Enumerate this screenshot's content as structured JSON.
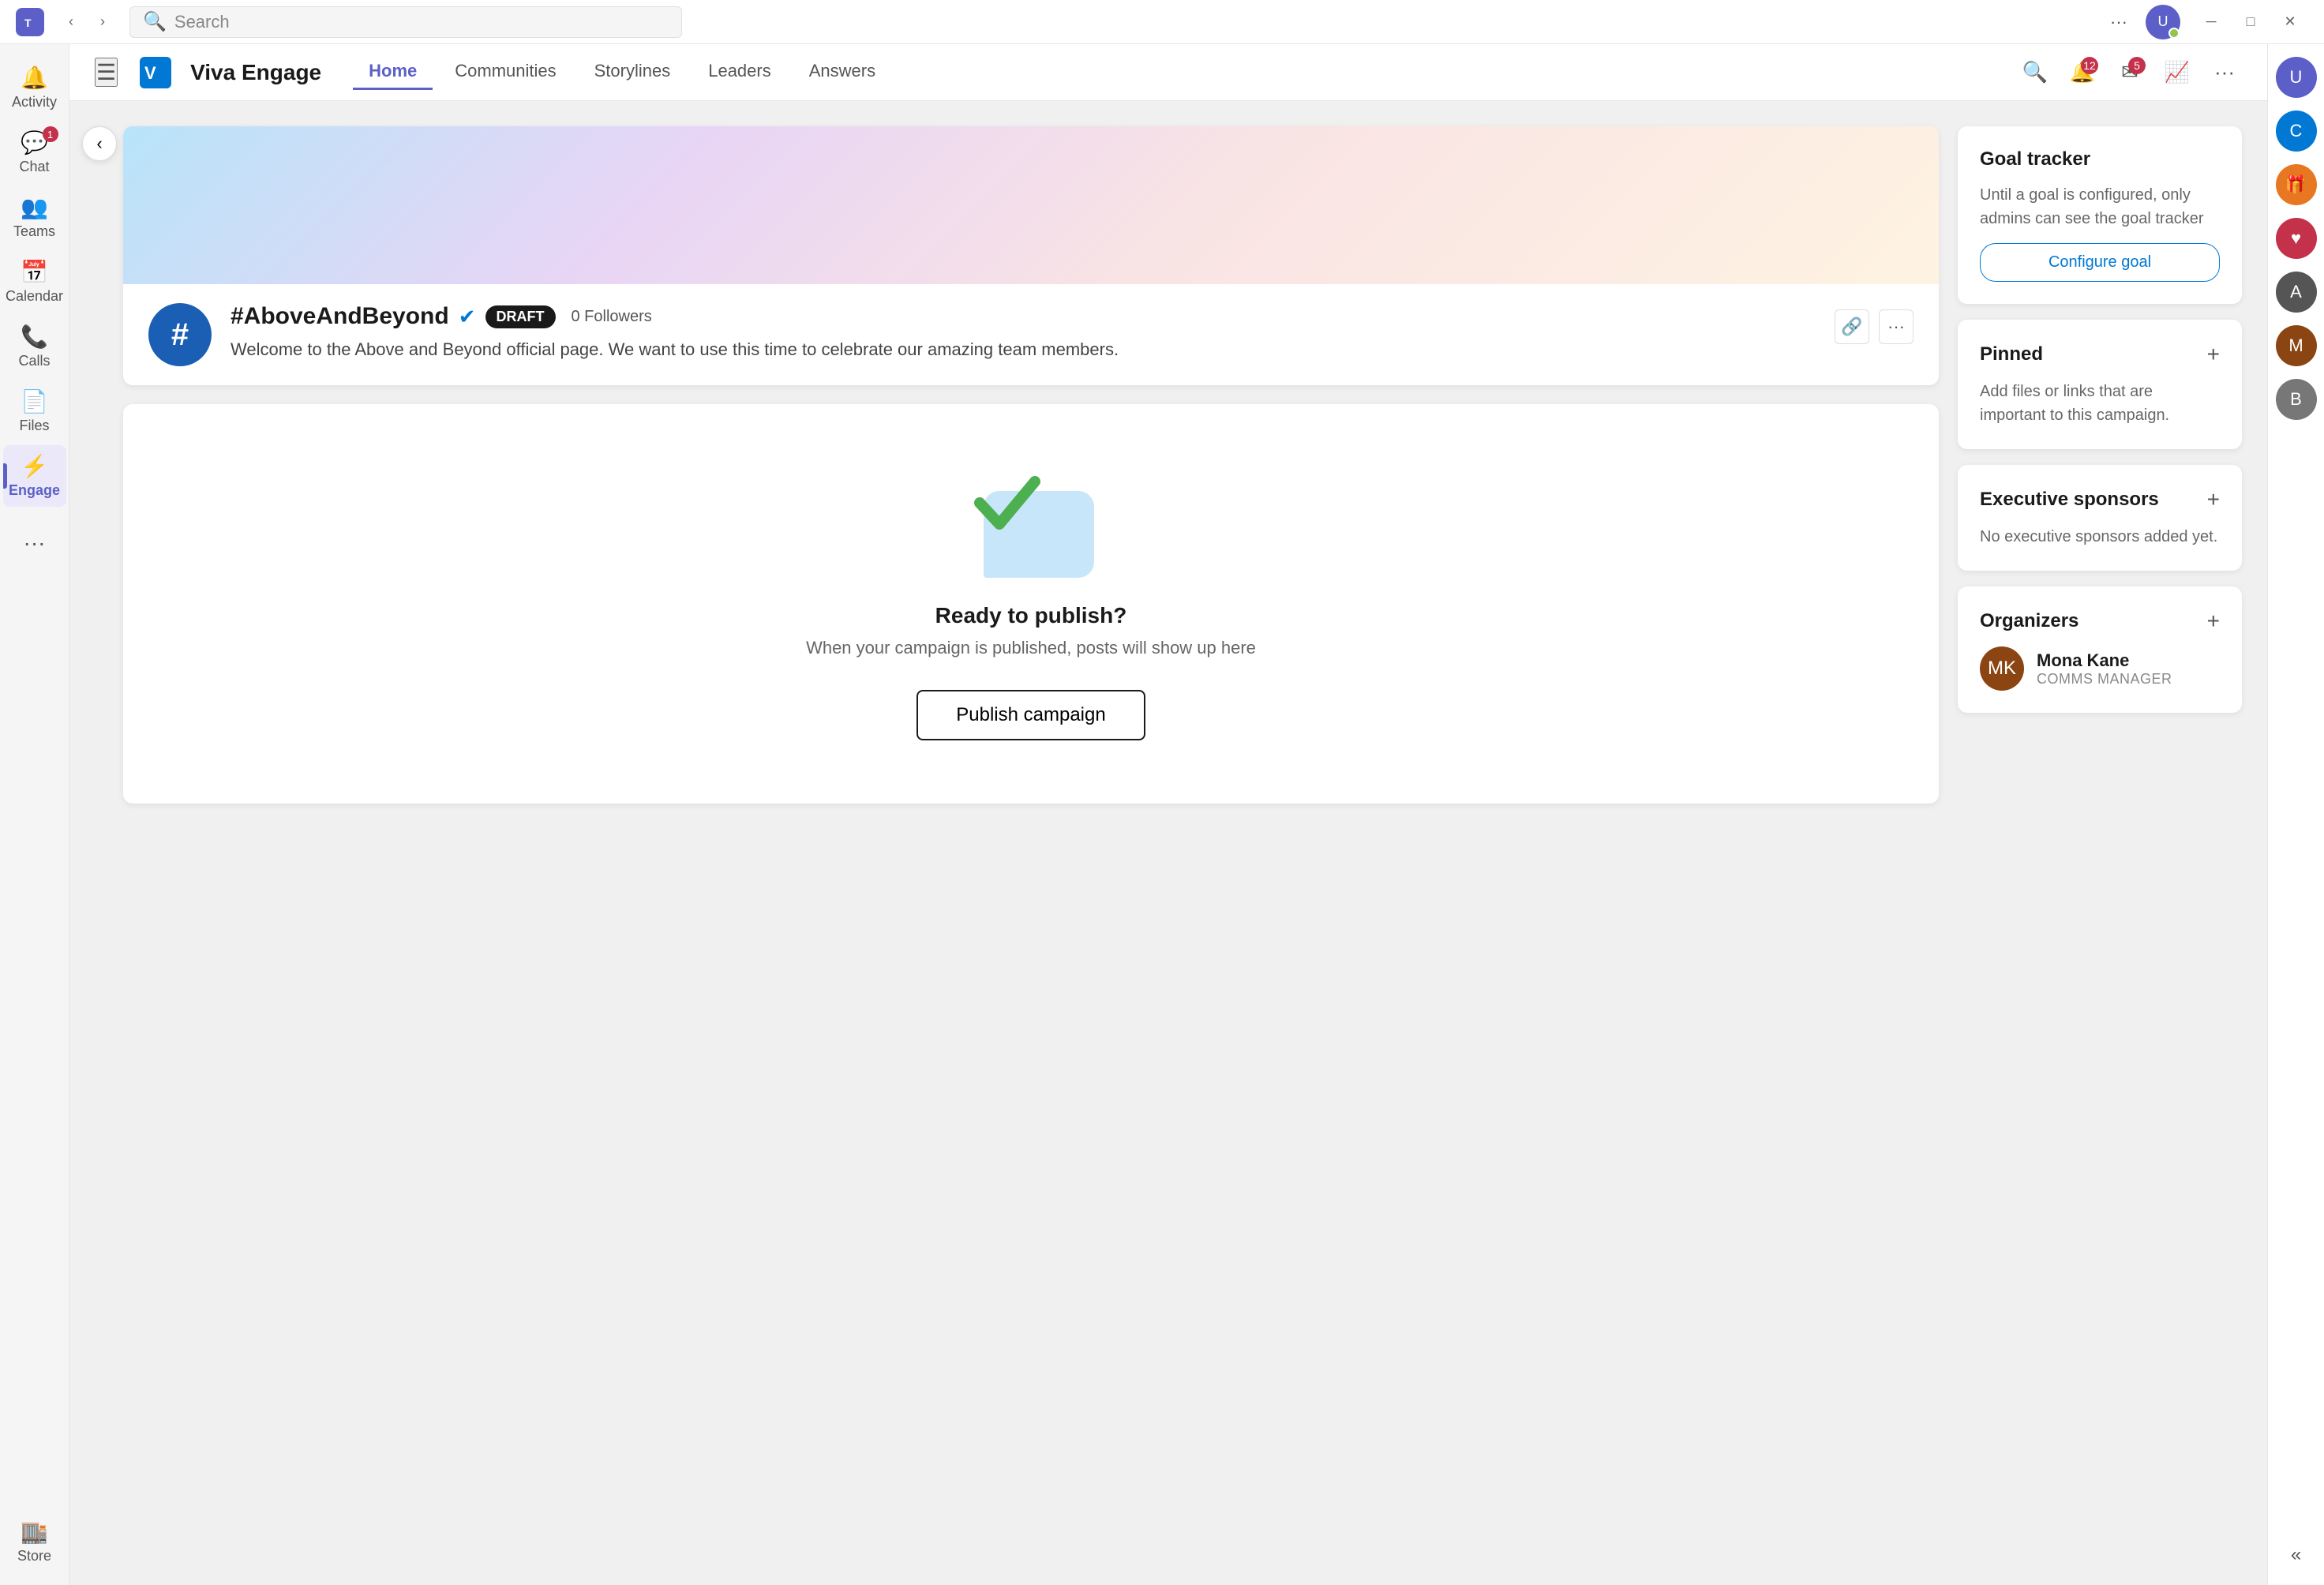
{
  "titlebar": {
    "search_placeholder": "Search",
    "more_label": "···"
  },
  "sidebar": {
    "items": [
      {
        "id": "activity",
        "label": "Activity",
        "icon": "🔔",
        "badge": null,
        "active": false
      },
      {
        "id": "chat",
        "label": "Chat",
        "icon": "💬",
        "badge": "1",
        "active": false
      },
      {
        "id": "teams",
        "label": "Teams",
        "icon": "👥",
        "badge": null,
        "active": false
      },
      {
        "id": "calendar",
        "label": "Calendar",
        "icon": "📅",
        "badge": null,
        "active": false
      },
      {
        "id": "calls",
        "label": "Calls",
        "icon": "📞",
        "badge": null,
        "active": false
      },
      {
        "id": "files",
        "label": "Files",
        "icon": "📄",
        "badge": null,
        "active": false
      },
      {
        "id": "engage",
        "label": "Engage",
        "icon": "⚡",
        "badge": null,
        "active": true
      }
    ],
    "more_label": "···",
    "store_label": "Store"
  },
  "header": {
    "app_name": "Viva Engage",
    "nav_items": [
      {
        "id": "home",
        "label": "Home",
        "active": true
      },
      {
        "id": "communities",
        "label": "Communities",
        "active": false
      },
      {
        "id": "storylines",
        "label": "Storylines",
        "active": false
      },
      {
        "id": "leaders",
        "label": "Leaders",
        "active": false
      },
      {
        "id": "answers",
        "label": "Answers",
        "active": false
      }
    ],
    "notifications_badge": "12",
    "messages_badge": "5"
  },
  "campaign": {
    "hashtag": "#",
    "title": "#AboveAndBeyond",
    "draft_label": "DRAFT",
    "followers": "0 Followers",
    "description": "Welcome to the Above and Beyond official page. We want to use this time to celebrate our amazing team members.",
    "verified": true
  },
  "publish_section": {
    "title": "Ready to publish?",
    "subtitle": "When your campaign is published, posts will show up here",
    "button_label": "Publish campaign"
  },
  "goal_tracker": {
    "title": "Goal tracker",
    "description": "Until a goal is configured, only admins can see the goal tracker",
    "configure_label": "Configure goal"
  },
  "pinned": {
    "title": "Pinned",
    "description": "Add files or links that are important to this campaign."
  },
  "executive_sponsors": {
    "title": "Executive sponsors",
    "description": "No executive sponsors added yet."
  },
  "organizers": {
    "title": "Organizers",
    "items": [
      {
        "name": "Mona Kane",
        "role": "COMMS MANAGER",
        "initials": "MK"
      }
    ]
  }
}
